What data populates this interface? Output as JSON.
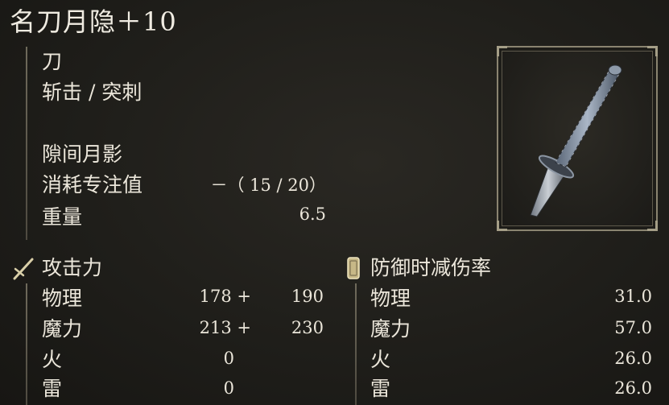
{
  "item": {
    "name": "名刀月隐＋10",
    "weapon_type": "刀",
    "attack_type": "斩击 / 突刺",
    "skill": "隙间月影",
    "fp_cost_label": "消耗专注值",
    "fp_cost_value": "－（ 15 / 20）",
    "weight_label": "重量",
    "weight_value": "6.5"
  },
  "attack": {
    "title": "攻击力",
    "icon": "sword-icon",
    "rows": [
      {
        "label": "物理",
        "base": "178 +",
        "bonus": "190"
      },
      {
        "label": "魔力",
        "base": "213 +",
        "bonus": "230"
      },
      {
        "label": "火",
        "base": "0",
        "bonus": ""
      },
      {
        "label": "雷",
        "base": "0",
        "bonus": ""
      }
    ]
  },
  "guard": {
    "title": "防御时减伤率",
    "icon": "shield-icon",
    "rows": [
      {
        "label": "物理",
        "value": "31.0"
      },
      {
        "label": "魔力",
        "value": "57.0"
      },
      {
        "label": "火",
        "value": "26.0"
      },
      {
        "label": "雷",
        "value": "26.0"
      }
    ]
  },
  "colors": {
    "text": "#ebe6da",
    "frame": "#8a8470",
    "background": "#1f1e1a"
  }
}
